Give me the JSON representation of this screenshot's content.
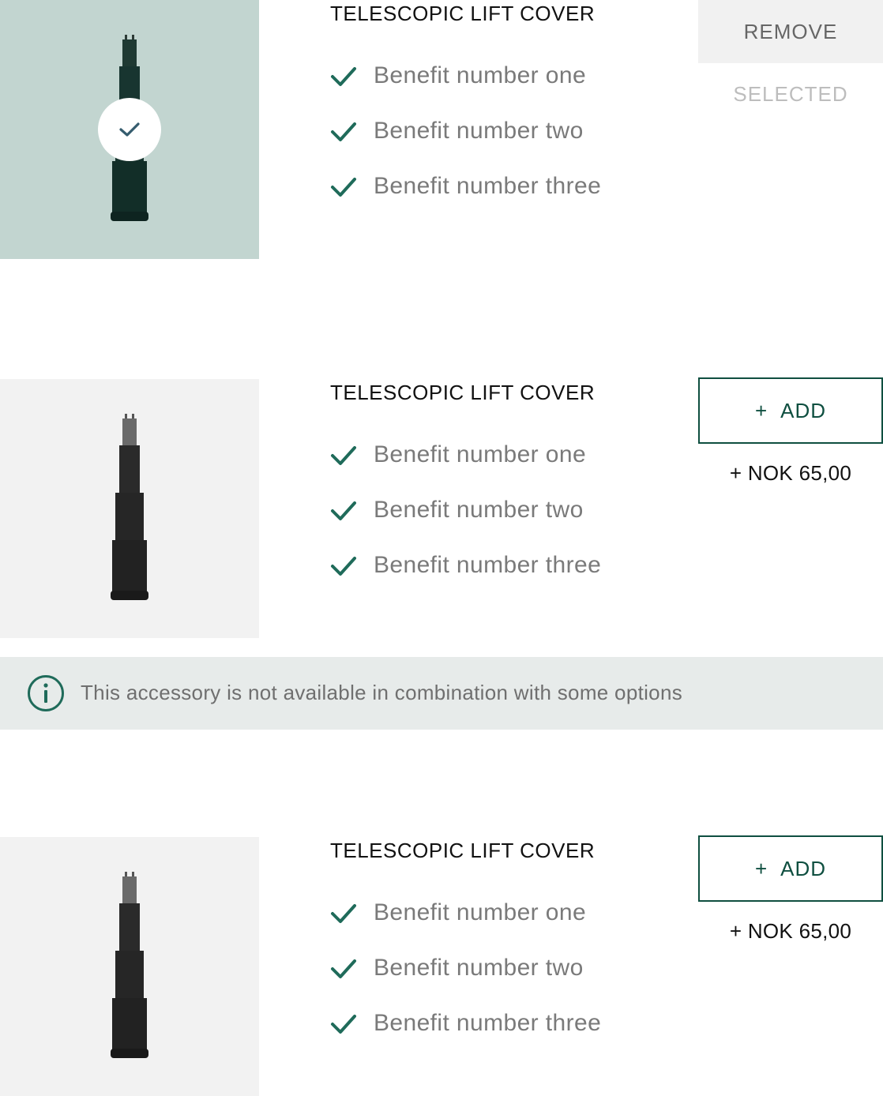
{
  "colors": {
    "accent": "#0f4f40",
    "check": "#1f6b5a",
    "selected_bg": "#c2d5d0",
    "thumb_bg": "#f2f2f2",
    "info_bg": "#e7ebea"
  },
  "cards": [
    {
      "title": "TELESCOPIC LIFT COVER",
      "benefits": [
        "Benefit number one",
        "Benefit number two",
        "Benefit number three"
      ],
      "action_label": "REMOVE",
      "status_text": "SELECTED",
      "selected": true
    },
    {
      "title": "TELESCOPIC LIFT COVER",
      "benefits": [
        "Benefit number one",
        "Benefit number two",
        "Benefit number three"
      ],
      "action_icon": "+",
      "action_label": "ADD",
      "price": "+ NOK 65,00",
      "selected": false
    },
    {
      "title": "TELESCOPIC LIFT COVER",
      "benefits": [
        "Benefit number one",
        "Benefit number two",
        "Benefit number three"
      ],
      "action_icon": "+",
      "action_label": "ADD",
      "price": "+ NOK 65,00",
      "selected": false
    }
  ],
  "info_banner": {
    "icon": "info-icon",
    "text": "This accessory is not available in combination with some options"
  }
}
